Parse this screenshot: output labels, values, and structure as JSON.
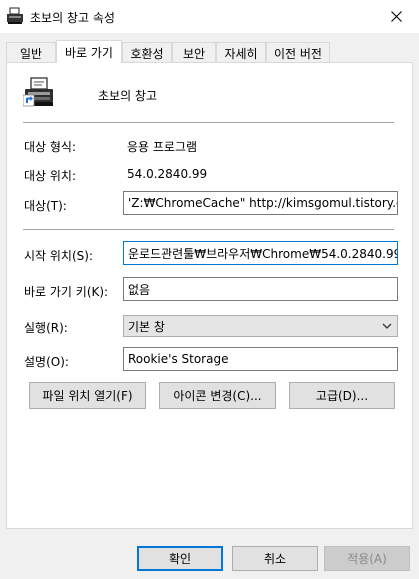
{
  "window": {
    "title": "초보의 창고 속성"
  },
  "tabs": [
    {
      "label": "일반",
      "active": false
    },
    {
      "label": "바로 가기",
      "active": true
    },
    {
      "label": "호환성",
      "active": false
    },
    {
      "label": "보안",
      "active": false
    },
    {
      "label": "자세히",
      "active": false
    },
    {
      "label": "이전 버전",
      "active": false
    }
  ],
  "shortcut": {
    "name": "초보의 창고",
    "icon": "typewriter-app-icon"
  },
  "fields": {
    "target_type_label": "대상 형식:",
    "target_type_value": "응용 프로그램",
    "target_location_label": "대상 위치:",
    "target_location_value": "54.0.2840.99",
    "target_label": "대상(T):",
    "target_value": "'Z:₩ChromeCache\" http://kimsgomul.tistory.com",
    "start_in_label": "시작 위치(S):",
    "start_in_value": "운로드관련툴₩브라우저₩Chrome₩54.0.2840.99\"",
    "shortcut_key_label": "바로 가기 키(K):",
    "shortcut_key_value": "없음",
    "run_label": "실행(R):",
    "run_value": "기본 창",
    "comment_label": "설명(O):",
    "comment_value": "Rookie's Storage"
  },
  "buttons": {
    "open_location": "파일 위치 열기(F)",
    "change_icon": "아이콘 변경(C)...",
    "advanced": "고급(D)...",
    "ok": "확인",
    "cancel": "취소",
    "apply": "적용(A)"
  },
  "colors": {
    "accent": "#0078d7",
    "background": "#f0f0f0",
    "panel": "#ffffff"
  }
}
